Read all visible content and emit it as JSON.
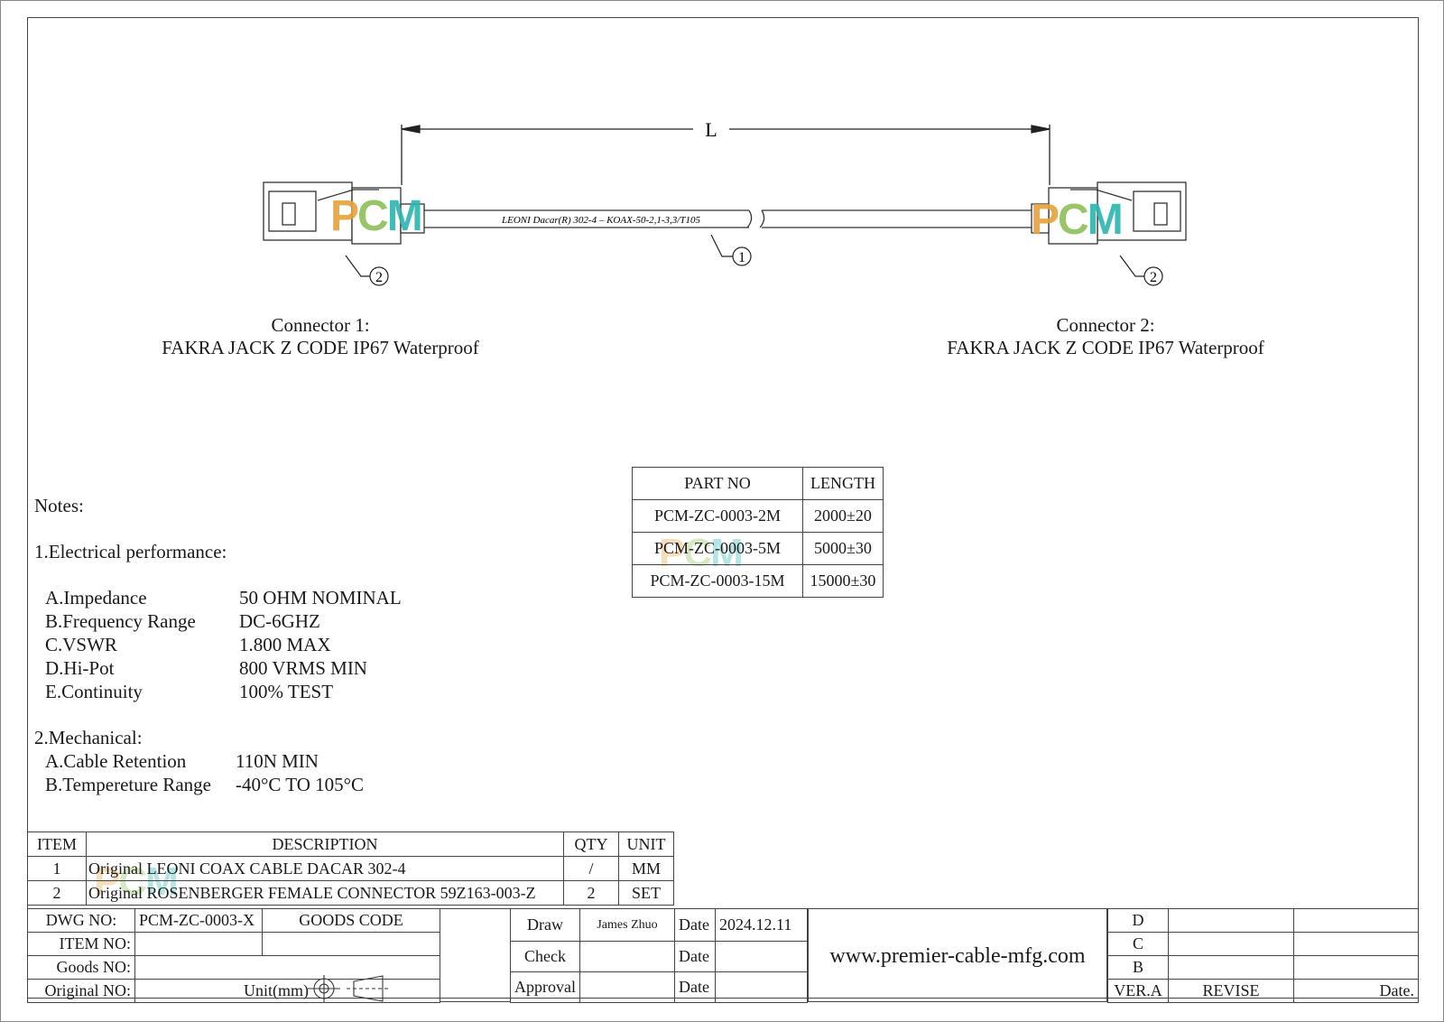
{
  "drawing": {
    "dimension_label": "L",
    "cable_print": "LEONI Dacar(R) 302-4 – KOAX-50-2,1-3,3/T105",
    "balloon_cable": "1",
    "balloon_connector_left": "2",
    "balloon_connector_right": "2",
    "watermark": {
      "p": "P",
      "c": "C",
      "m": "M"
    },
    "colors": {
      "watermark_p": "#e5a33b",
      "watermark_c": "#8fbf5a",
      "watermark_m": "#2bb5b0"
    }
  },
  "connector1": {
    "title": "Connector 1:",
    "desc": "FAKRA JACK Z CODE IP67 Waterproof"
  },
  "connector2": {
    "title": "Connector 2:",
    "desc": "FAKRA JACK Z CODE IP67 Waterproof"
  },
  "parts_table": {
    "headers": [
      "PART NO",
      "LENGTH"
    ],
    "rows": [
      [
        "PCM-ZC-0003-2M",
        "2000±20"
      ],
      [
        "PCM-ZC-0003-5M",
        "5000±30"
      ],
      [
        "PCM-ZC-0003-15M",
        "15000±30"
      ]
    ]
  },
  "notes": {
    "heading": "Notes:",
    "electrical_heading": "1.Electrical performance:",
    "electrical": [
      [
        "A.Impedance",
        "50 OHM NOMINAL"
      ],
      [
        "B.Frequency Range",
        "DC-6GHZ"
      ],
      [
        "C.VSWR",
        "1.800 MAX"
      ],
      [
        "D.Hi-Pot",
        "800 VRMS MIN"
      ],
      [
        "E.Continuity",
        "100% TEST"
      ]
    ],
    "mechanical_heading": "2.Mechanical:",
    "mechanical": [
      [
        "A.Cable Retention",
        "110N MIN"
      ],
      [
        "B.Tempereture Range",
        "-40°C TO 105°C"
      ]
    ]
  },
  "bom": {
    "headers": [
      "ITEM",
      "DESCRIPTION",
      "QTY",
      "UNIT"
    ],
    "rows": [
      [
        "1",
        "Original LEONI COAX CABLE DACAR 302-4",
        "/",
        "MM"
      ],
      [
        "2",
        "Original ROSENBERGER FEMALE CONNECTOR 59Z163-003-Z",
        "2",
        "SET"
      ]
    ]
  },
  "title_block": {
    "dwg_no_label": "DWG NO:",
    "dwg_no": "PCM-ZC-0003-X",
    "goods_code_label": "GOODS CODE",
    "item_no_label": "ITEM NO:",
    "goods_no_label": "Goods NO:",
    "original_no_label": "Original NO:",
    "unit_label": "Unit(mm)",
    "draw_label": "Draw",
    "drawer": "James Zhuo",
    "check_label": "Check",
    "approval_label": "Approval",
    "date_label": "Date",
    "date_value": "2024.12.11",
    "website": "www.premier-cable-mfg.com",
    "revisions": [
      "D",
      "C",
      "B"
    ],
    "ver_label": "VER.A",
    "revise_label": "REVISE",
    "rev_date_label": "Date."
  }
}
